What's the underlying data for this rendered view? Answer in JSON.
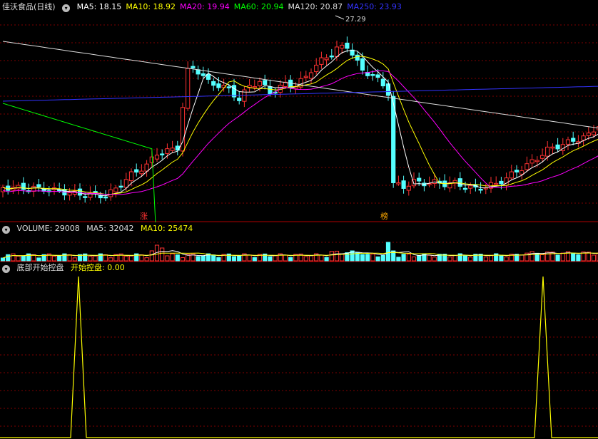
{
  "main": {
    "title": "佳沃食品(日线)",
    "ma": [
      {
        "label": "MA5: 18.15",
        "color": "#ffffff"
      },
      {
        "label": "MA10: 18.92",
        "color": "#ffff00"
      },
      {
        "label": "MA20: 19.94",
        "color": "#ff00ff"
      },
      {
        "label": "MA60: 20.94",
        "color": "#00ff00"
      },
      {
        "label": "MA120: 20.87",
        "color": "#dddddd"
      },
      {
        "label": "MA250: 23.93",
        "color": "#3333ff"
      }
    ],
    "high_label": "27.29",
    "marker_zhang": "涨",
    "marker_bang": "榜"
  },
  "volume": {
    "label": "VOLUME: 29008",
    "ma5": "MA5: 32042",
    "ma10": "MA10: 25474"
  },
  "indicator": {
    "name": "底部开始控盘",
    "value": "开始控盘: 0.00"
  },
  "colors": {
    "up": "#ff3232",
    "down": "#54ffff",
    "grid": "#800000",
    "ma5": "#ffffff",
    "ma10": "#ffff00",
    "ma20": "#ff00ff",
    "ma60": "#00ff00",
    "ma120": "#dddddd",
    "ma250": "#3333ff"
  }
}
